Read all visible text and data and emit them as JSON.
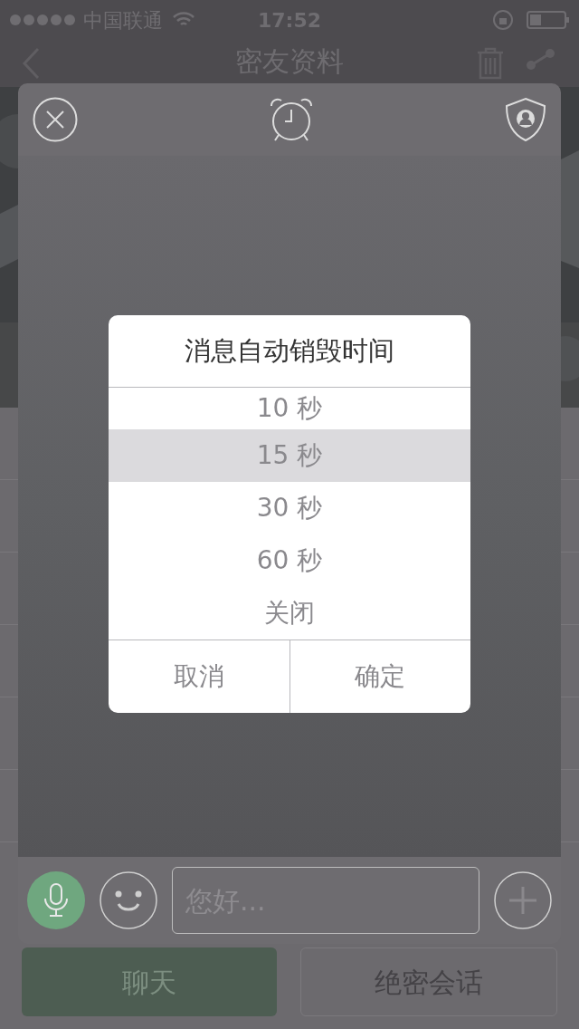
{
  "status_bar": {
    "carrier": "中国联通",
    "time": "17:52"
  },
  "nav": {
    "title": "密友资料"
  },
  "actions": [
    {
      "label": "聊天",
      "kind": "primary"
    },
    {
      "label": "绝密会话",
      "kind": "outline"
    }
  ],
  "dialog": {
    "title": "消息自动销毁时间",
    "options": [
      {
        "label": "10 秒",
        "selected": false
      },
      {
        "label": "15 秒",
        "selected": true
      },
      {
        "label": "30 秒",
        "selected": false
      },
      {
        "label": "60 秒",
        "selected": false
      },
      {
        "label": "关闭",
        "selected": false
      }
    ],
    "buttons": [
      "取消",
      "确定"
    ]
  },
  "composer": {
    "placeholder": "您好..."
  }
}
